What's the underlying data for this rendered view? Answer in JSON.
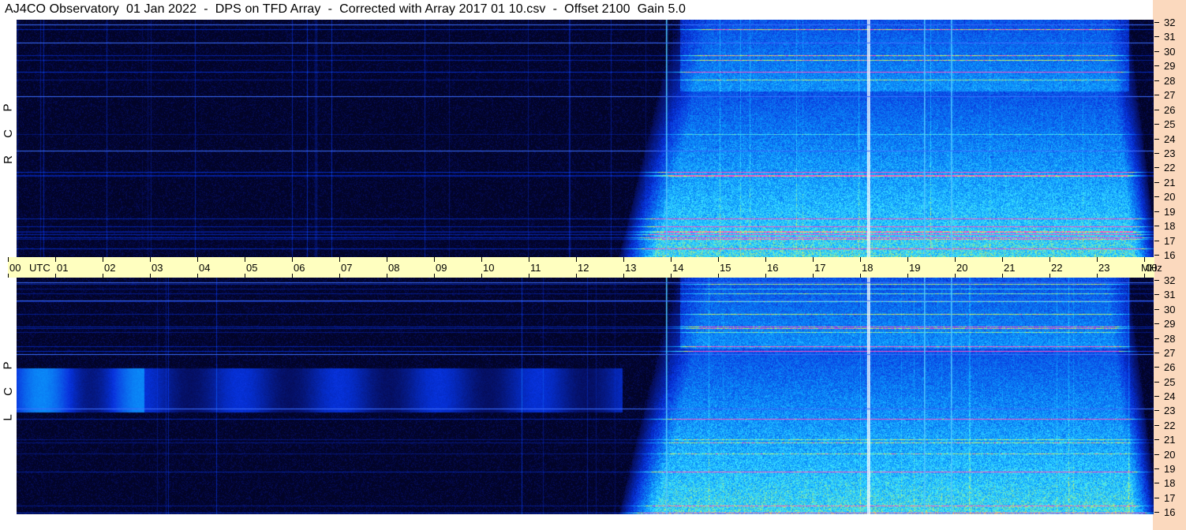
{
  "title": "AJ4CO Observatory  01 Jan 2022  -  DPS on TFD Array  -  Corrected with Array 2017 01 10.csv  -  Offset 2100  Gain 5.0",
  "panels": [
    {
      "id": "rcp",
      "label_letters": [
        "P",
        "C",
        "R"
      ]
    },
    {
      "id": "lcp",
      "label_letters": [
        "P",
        "C",
        "L"
      ]
    }
  ],
  "utc_axis": {
    "unit_label": "UTC",
    "hours": [
      "00",
      "01",
      "02",
      "03",
      "04",
      "05",
      "06",
      "07",
      "08",
      "09",
      "10",
      "11",
      "12",
      "13",
      "14",
      "15",
      "16",
      "17",
      "18",
      "19",
      "20",
      "21",
      "22",
      "23",
      "00"
    ]
  },
  "mhz_axis": {
    "unit_label": "MHz",
    "ticks": [
      "32",
      "31",
      "30",
      "29",
      "28",
      "27",
      "26",
      "25",
      "24",
      "23",
      "22",
      "21",
      "20",
      "19",
      "18",
      "17",
      "16"
    ]
  },
  "colors": {
    "background_spectro": "#020428",
    "strip": "#fbd9be",
    "utc_bar": "#ffffc0"
  }
}
